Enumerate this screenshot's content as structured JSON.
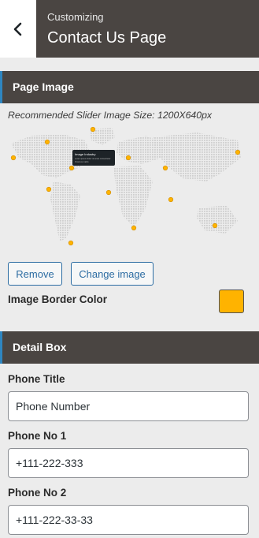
{
  "header": {
    "back_icon": "chevron-left-icon",
    "subtitle": "Customizing",
    "title": "Contact Us Page"
  },
  "page_image_section": {
    "title": "Page Image",
    "hint": "Recommended Slider Image Size: 1200X640px",
    "map_tooltip": {
      "title": "Image Industry",
      "line1": "Lorem ipsum dolor sit amet consectetur",
      "line2": "Vivamus mattis"
    },
    "remove_label": "Remove",
    "change_label": "Change image",
    "border_color_label": "Image Border Color",
    "border_color": "#ffb300"
  },
  "detail_box_section": {
    "title": "Detail Box",
    "fields": [
      {
        "label": "Phone Title",
        "value": "Phone Number"
      },
      {
        "label": "Phone No 1",
        "value": "+111-222-333"
      },
      {
        "label": "Phone No 2",
        "value": "+111-222-33-33"
      }
    ]
  },
  "colors": {
    "header_bg": "#4a4542",
    "accent": "#2e86c1",
    "button_text": "#2d6da3",
    "pin": "#ffb300"
  }
}
